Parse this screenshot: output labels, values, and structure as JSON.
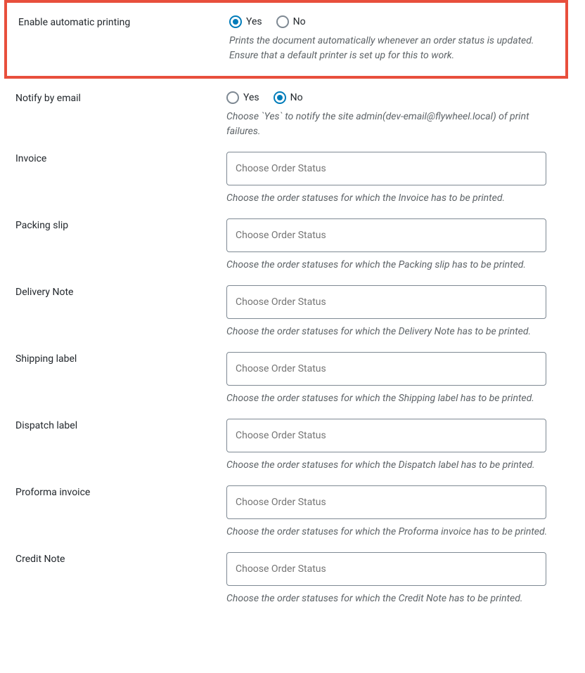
{
  "options": {
    "yes": "Yes",
    "no": "No"
  },
  "placeholder": "Choose Order Status",
  "rows": {
    "enable_auto": {
      "label": "Enable automatic printing",
      "help": "Prints the document automatically whenever an order status is updated. Ensure that a default printer is set up for this to work."
    },
    "notify_email": {
      "label": "Notify by email",
      "help": "Choose `Yes` to notify the site admin(dev-email@flywheel.local) of print failures."
    },
    "invoice": {
      "label": "Invoice",
      "help": "Choose the order statuses for which the Invoice has to be printed."
    },
    "packing_slip": {
      "label": "Packing slip",
      "help": "Choose the order statuses for which the Packing slip has to be printed."
    },
    "delivery_note": {
      "label": "Delivery Note",
      "help": "Choose the order statuses for which the Delivery Note has to be printed."
    },
    "shipping_label": {
      "label": "Shipping label",
      "help": "Choose the order statuses for which the Shipping label has to be printed."
    },
    "dispatch_label": {
      "label": "Dispatch label",
      "help": "Choose the order statuses for which the Dispatch label has to be printed."
    },
    "proforma_invoice": {
      "label": "Proforma invoice",
      "help": "Choose the order statuses for which the Proforma invoice has to be printed."
    },
    "credit_note": {
      "label": "Credit Note",
      "help": "Choose the order statuses for which the Credit Note has to be printed."
    }
  }
}
